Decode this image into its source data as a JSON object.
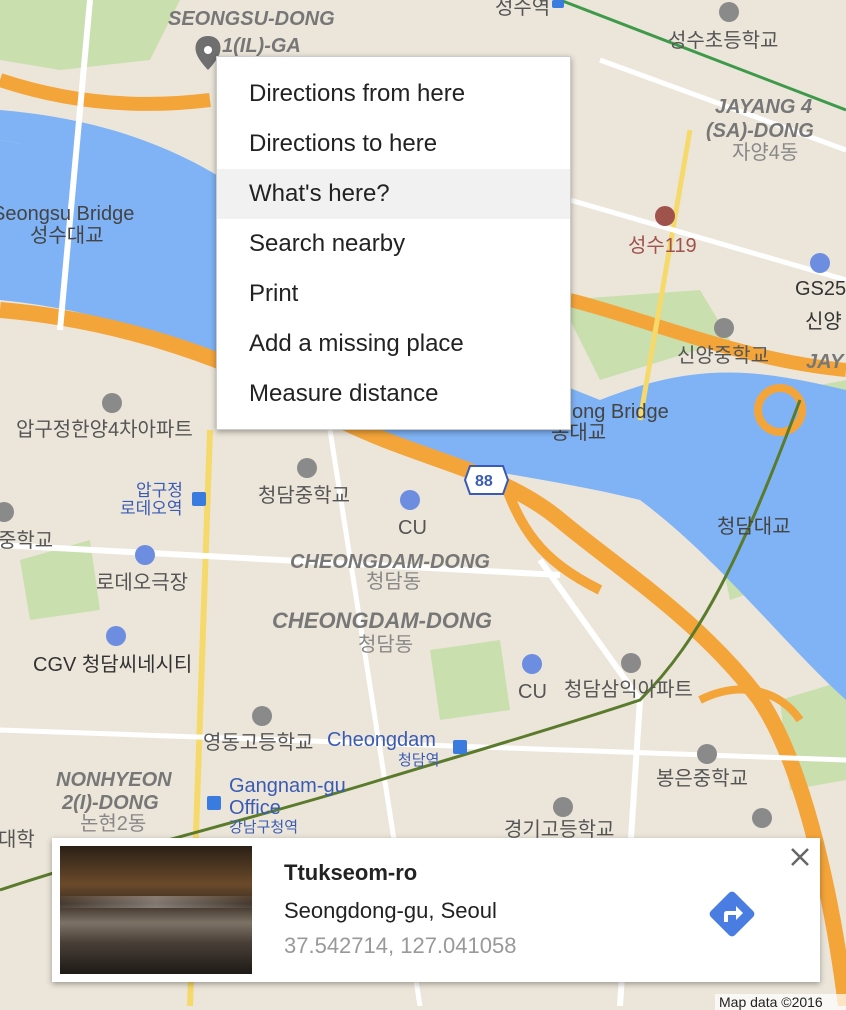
{
  "map": {
    "labels": {
      "seongsu_dong": "SEONGSU-DONG",
      "seongsu_dong_sub": "1(IL)-GA",
      "seongsuyeok": "성수역",
      "seongsu_elem": "성수초등학교",
      "jayang_1": "JAYANG 4",
      "jayang_2": "(SA)-DONG",
      "jayang_ko": "자양4동",
      "seongsu119": "성수119",
      "gs25": "GS25",
      "sinyang_cut": "신양",
      "jay_cut": "JAY",
      "seongsu_bridge_en": "Seongsu Bridge",
      "seongsu_bridge_ko": "성수대교",
      "sinyang_middle": "신양중학교",
      "bridge_right_en": "ong Bridge",
      "bridge_right_ko": "동대교",
      "apgujeong_apt": "압구정한양4차아파트",
      "route88": "88",
      "apgujeong_rodeo1": "압구정",
      "apgujeong_rodeo2": "로데오역",
      "cheongdam_middle": "청담중학교",
      "cu1": "CU",
      "cheongdam_bridge": "청담대교",
      "middle_left": "중학교",
      "cheongdam_dong1_en": "CHEONGDAM-DONG",
      "cheongdam_dong1_ko": "청담동",
      "rodeo_theater": "로데오극장",
      "cheongdam_dong2_en": "CHEONGDAM-DONG",
      "cheongdam_dong2_ko": "청담동",
      "cgv": "CGV 청담씨네시티",
      "cu2": "CU",
      "cheongdam_samik": "청담삼익아파트",
      "youngdong_high": "영동고등학교",
      "cheongdam_en": "Cheongdam",
      "cheongdam_station": "청담역",
      "nonhyeon_1": "NONHYEON",
      "nonhyeon_2": "2(I)-DONG",
      "nonhyeon_ko": "논현2동",
      "gangnam_1": "Gangnam-gu",
      "gangnam_2": "Office",
      "gangnam_ko": "강남구청역",
      "bongeun_middle": "봉은중학교",
      "university_cut": "대학",
      "gyeonggi_high": "경기고등학교"
    }
  },
  "context_menu": {
    "items": [
      "Directions from here",
      "Directions to here",
      "What's here?",
      "Search nearby",
      "Print",
      "Add a missing place",
      "Measure distance"
    ],
    "highlighted_index": 2
  },
  "info_card": {
    "title": "Ttukseom-ro",
    "address": "Seongdong-gu, Seoul",
    "coordinates": "37.542714, 127.041058",
    "directions_icon": "directions-diamond-icon",
    "close_icon": "close-icon"
  },
  "footer": {
    "map_data": "Map data ©2016"
  },
  "colors": {
    "water": "#7fb3f5",
    "highway": "#f4a53a",
    "park": "#c9dfae",
    "land": "#ece6da",
    "subway": "#5a7a2c",
    "directions": "#4a7de2"
  }
}
